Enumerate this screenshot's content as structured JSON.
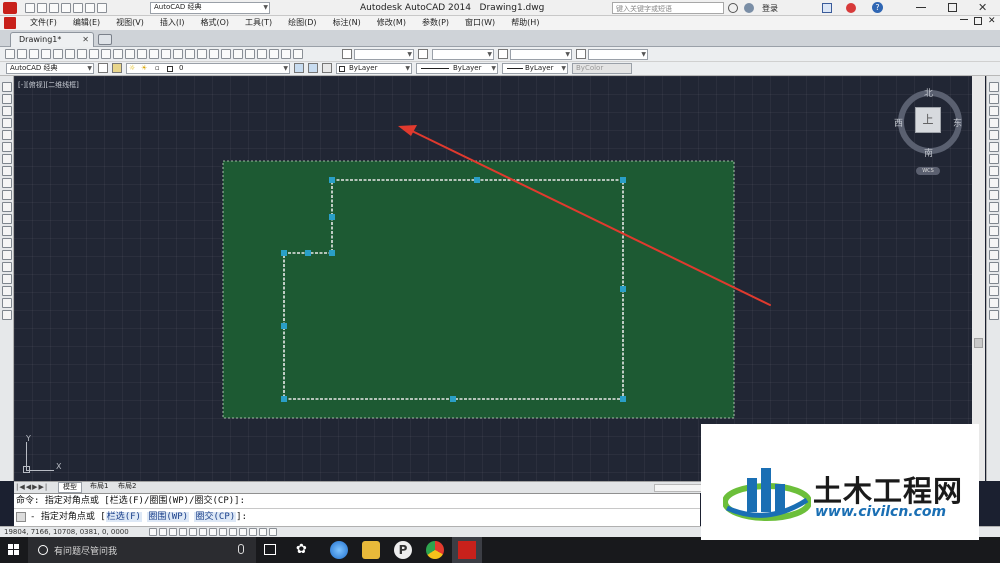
{
  "titlebar": {
    "workspace": "AutoCAD 经典",
    "app_title": "Autodesk AutoCAD 2014",
    "file_title": "Drawing1.dwg",
    "search_placeholder": "键入关键字或短语",
    "login_label": "登录"
  },
  "menu": [
    "文件(F)",
    "编辑(E)",
    "视图(V)",
    "插入(I)",
    "格式(O)",
    "工具(T)",
    "绘图(D)",
    "标注(N)",
    "修改(M)",
    "参数(P)",
    "窗口(W)",
    "帮助(H)"
  ],
  "doc_tab": {
    "label": "Drawing1*"
  },
  "toolbar2": {
    "workspace_select": "AutoCAD 经典",
    "layer_select": "0",
    "color_select": "ByLayer",
    "linetype_select": "ByLayer",
    "lineweight_select": "ByLayer",
    "plotstyle_select": "ByColor"
  },
  "viewport": {
    "label": "[-][俯视][二维线框]",
    "viewcube": {
      "north": "北",
      "south": "南",
      "east": "东",
      "west": "西",
      "top": "上",
      "wcs": "WCS"
    },
    "ucs": {
      "x_label": "X",
      "y_label": "Y"
    }
  },
  "layout_tabs": [
    "模型",
    "布局1",
    "布局2"
  ],
  "command": {
    "history_prefix": "命令: 指定对角点或 [",
    "history_opt1": "栏选(F)",
    "history_sep1": "/",
    "history_opt2": "圈围(WP)",
    "history_sep2": "/",
    "history_opt3": "圈交(CP)",
    "history_suffix": "]:",
    "prompt_prefix": "- 指定对角点或 [",
    "prompt_opt1": "栏选(F)",
    "prompt_opt2": "圈围(WP)",
    "prompt_opt3": "圈交(CP)",
    "prompt_suffix": "]:"
  },
  "status": {
    "coordinates": "19804, 7166, 10708, 0381, 0, 0000"
  },
  "taskbar": {
    "search_placeholder": "有问题尽管问我"
  },
  "watermark": {
    "brand": "土木工程网",
    "url": "www.civilcn.com"
  },
  "colors": {
    "canvas_bg": "#212634",
    "selection_fill": "#1d5a33",
    "polyline": "#e8e8e8",
    "grip": "#2a9fc7",
    "arrow": "#e03a2e",
    "brand_blue": "#1a6fb4",
    "brand_green": "#6cbf3a"
  }
}
